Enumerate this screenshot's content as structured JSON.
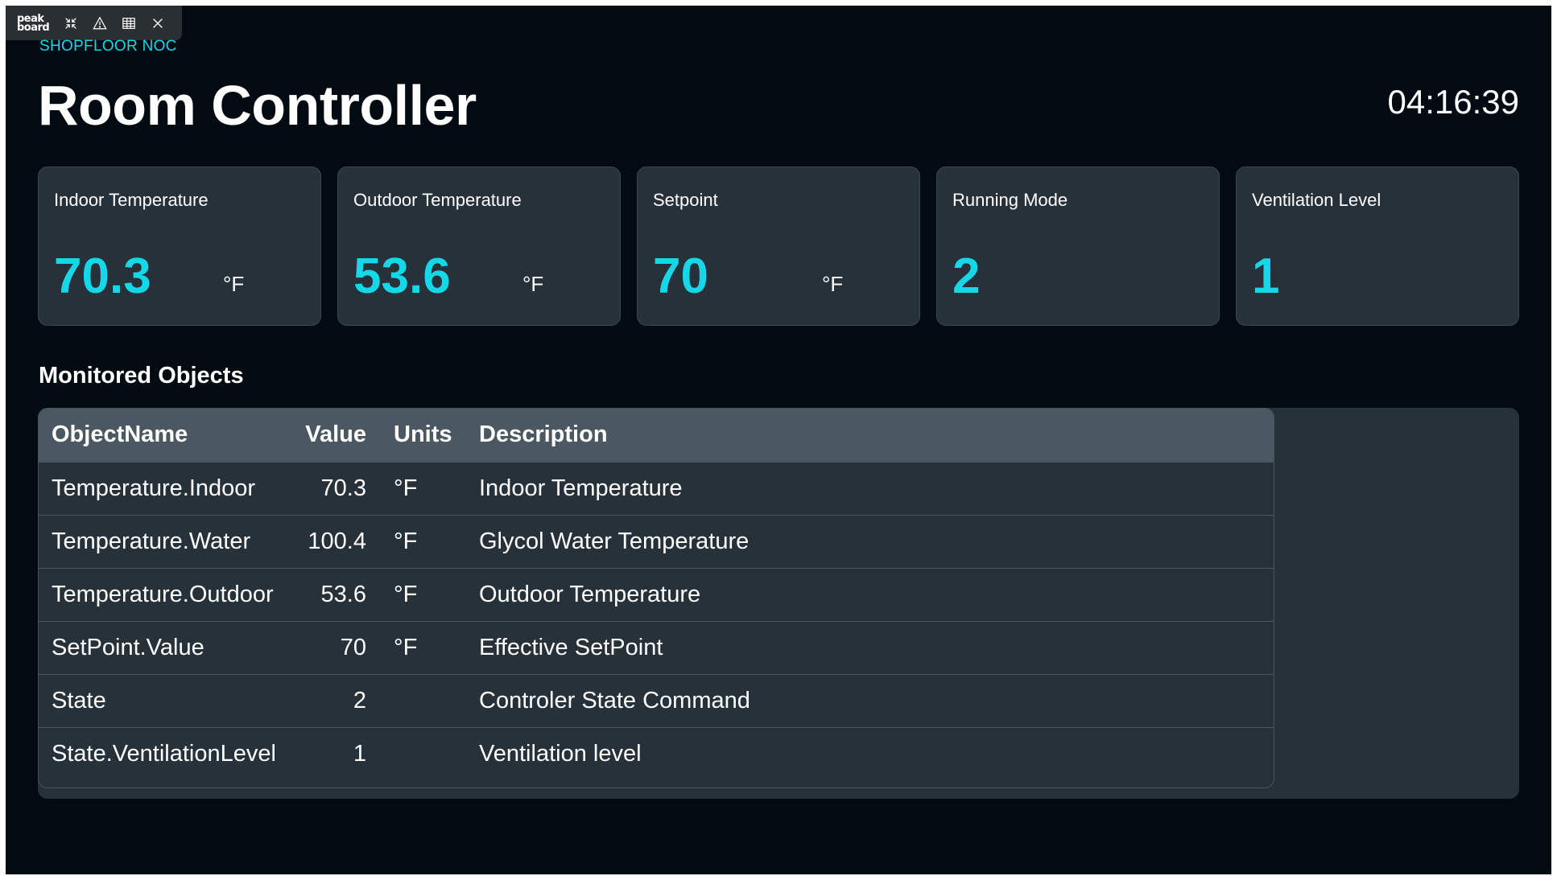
{
  "toolbar": {
    "logo_line1": "peak",
    "logo_line2": "board",
    "icons": [
      "collapse-icon",
      "warning-icon",
      "table-icon",
      "close-icon"
    ]
  },
  "header": {
    "subtitle": "SHOPFLOOR NOC",
    "title": "Room Controller",
    "clock": "04:16:39"
  },
  "colors": {
    "accent": "#16d7e8",
    "background": "#020b12",
    "card": "#26313a",
    "table_header": "#4c5861"
  },
  "cards": [
    {
      "label": "Indoor Temperature",
      "value": "70.3",
      "unit": "°F"
    },
    {
      "label": "Outdoor Temperature",
      "value": "53.6",
      "unit": "°F"
    },
    {
      "label": "Setpoint",
      "value": "70",
      "unit": "°F"
    },
    {
      "label": "Running Mode",
      "value": "2",
      "unit": ""
    },
    {
      "label": "Ventilation Level",
      "value": "1",
      "unit": ""
    }
  ],
  "monitored": {
    "title": "Monitored Objects",
    "columns": [
      "ObjectName",
      "Value",
      "Units",
      "Description"
    ],
    "rows": [
      {
        "name": "Temperature.Indoor",
        "value": "70.3",
        "units": "°F",
        "description": "Indoor Temperature"
      },
      {
        "name": "Temperature.Water",
        "value": "100.4",
        "units": "°F",
        "description": "Glycol Water Temperature"
      },
      {
        "name": "Temperature.Outdoor",
        "value": "53.6",
        "units": "°F",
        "description": "Outdoor Temperature"
      },
      {
        "name": "SetPoint.Value",
        "value": "70",
        "units": "°F",
        "description": "Effective SetPoint"
      },
      {
        "name": "State",
        "value": "2",
        "units": "",
        "description": "Controler State Command"
      },
      {
        "name": "State.VentilationLevel",
        "value": "1",
        "units": "",
        "description": "Ventilation level"
      }
    ]
  }
}
